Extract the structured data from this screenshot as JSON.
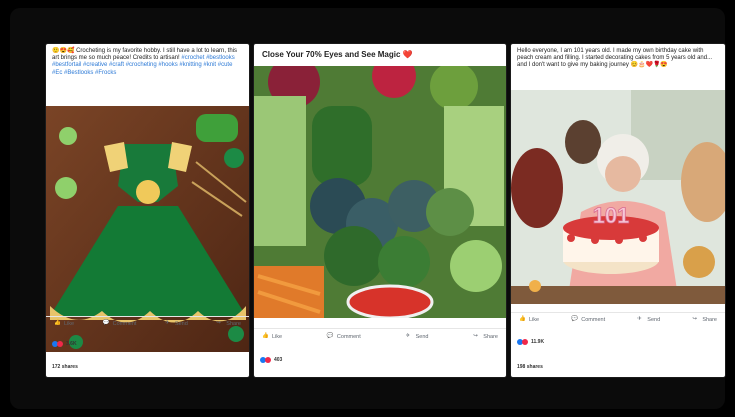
{
  "posts": [
    {
      "text": "🙂😍🥰 Crocheting is my favorite hobby. I still have a lot to learn, this art brings me so much peace! Credits to artisan!",
      "tags": "#crochet #bestlooks #bestfortail #creative #craft #crocheting #hooks #knitting #knit #cute #Ec #Bestlooks #Frocks",
      "actions": {
        "like": "Like",
        "comment": "Comment",
        "send": "Send",
        "share": "Share"
      },
      "reactions": "3.6K",
      "shares": "172 shares"
    },
    {
      "title": "Close Your 70% Eyes and See Magic ❤️",
      "actions": {
        "like": "Like",
        "comment": "Comment",
        "send": "Send",
        "share": "Share"
      },
      "reactions": "403"
    },
    {
      "text": "Hello everyone, I am 101 years old. I made my own birthday cake with peach cream and filling. I started decorating cakes from 5 years old and... and I don't want to give my baking journey 😊🎂❤️🌹😍",
      "cake_number": "101",
      "actions": {
        "like": "Like",
        "comment": "Comment",
        "send": "Send",
        "share": "Share"
      },
      "reactions": "11.9K",
      "shares": "198 shares"
    }
  ],
  "colors": {
    "like_blue": "#1877f2",
    "love_red": "#f0284a"
  }
}
